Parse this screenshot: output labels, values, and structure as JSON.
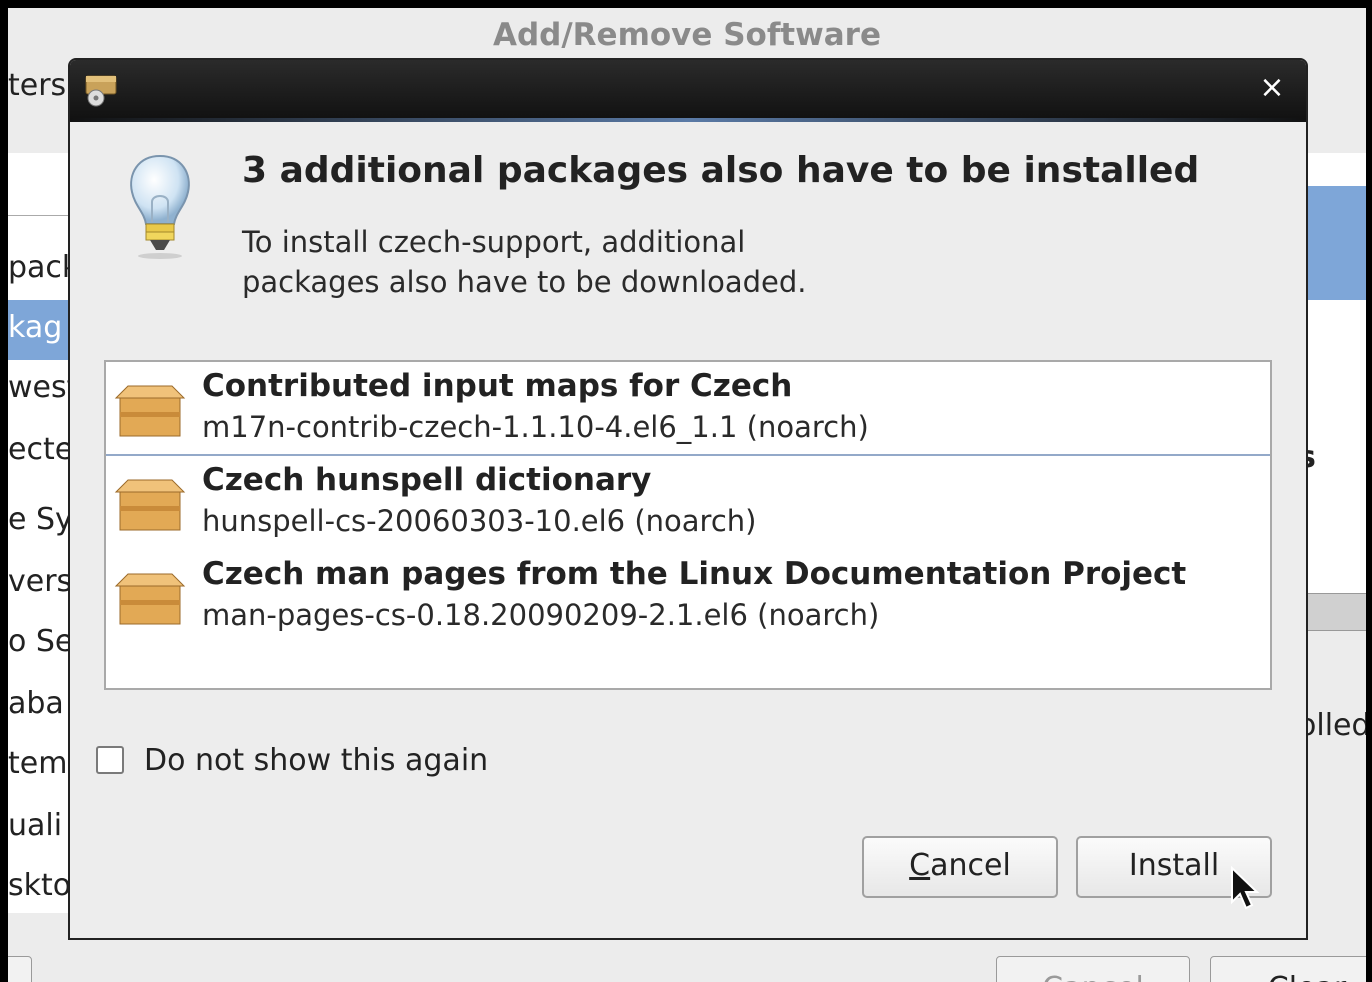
{
  "background_window": {
    "title": "Add/Remove Software",
    "left_tab_fragment": "ters",
    "list_fragments": [
      "pack",
      "kag",
      "west",
      "ecte",
      "e Sy",
      "vers",
      "o Se",
      "aba",
      "tem",
      "uali",
      "skto"
    ],
    "right_fragments": [
      "s",
      "olled"
    ],
    "bottom_buttons": [
      "Cancel",
      "Clear"
    ]
  },
  "dialog": {
    "close_glyph": "×",
    "headline": "3 additional packages also have to be installed",
    "message_line1": "To install czech-support, additional",
    "message_line2": "packages also have to be downloaded.",
    "packages": [
      {
        "name": "Contributed input maps for Czech",
        "version": "m17n-contrib-czech-1.1.10-4.el6_1.1 (noarch)"
      },
      {
        "name": "Czech hunspell dictionary",
        "version": "hunspell-cs-20060303-10.el6 (noarch)"
      },
      {
        "name": "Czech man pages from the Linux Documentation Project",
        "version": "man-pages-cs-0.18.20090209-2.1.el6 (noarch)"
      }
    ],
    "checkbox_label": "Do not show this again",
    "checkbox_checked": false,
    "cancel_label": "Cancel",
    "cancel_mnemonic": "C",
    "cancel_rest": "ancel",
    "install_label": "Install"
  }
}
